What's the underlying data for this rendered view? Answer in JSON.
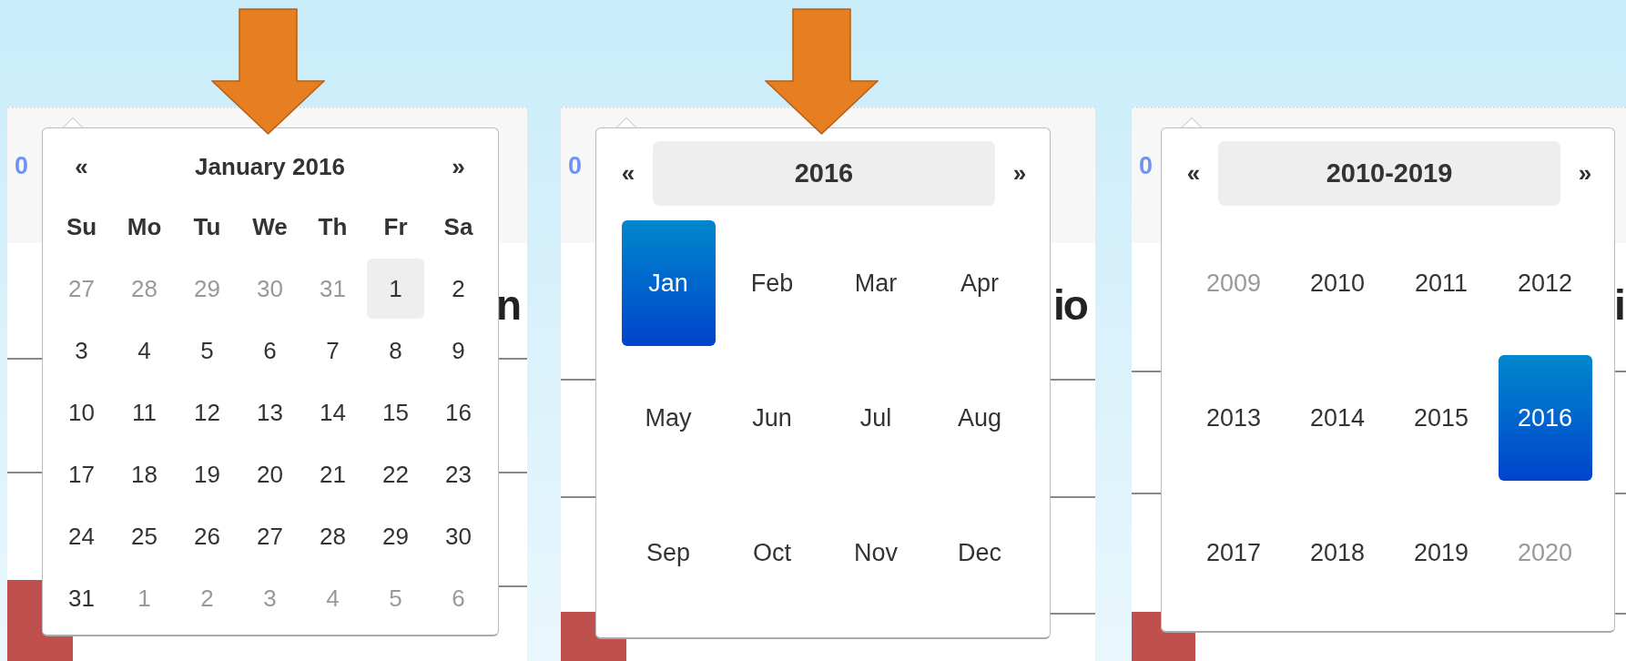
{
  "panels": [
    {
      "kind": "days",
      "pointer_arrow": true,
      "fragment_link": "0",
      "fragment_heading": "n",
      "picker": {
        "prev": "«",
        "title": "January 2016",
        "title_hovered": false,
        "next": "»",
        "weekdays": [
          "Su",
          "Mo",
          "Tu",
          "We",
          "Th",
          "Fr",
          "Sa"
        ],
        "cells": [
          {
            "label": "27",
            "muted": true,
            "selected": false,
            "hovered": false
          },
          {
            "label": "28",
            "muted": true,
            "selected": false,
            "hovered": false
          },
          {
            "label": "29",
            "muted": true,
            "selected": false,
            "hovered": false
          },
          {
            "label": "30",
            "muted": true,
            "selected": false,
            "hovered": false
          },
          {
            "label": "31",
            "muted": true,
            "selected": false,
            "hovered": false
          },
          {
            "label": "1",
            "muted": false,
            "selected": false,
            "hovered": true
          },
          {
            "label": "2",
            "muted": false,
            "selected": false,
            "hovered": false
          },
          {
            "label": "3",
            "muted": false,
            "selected": false,
            "hovered": false
          },
          {
            "label": "4",
            "muted": false,
            "selected": false,
            "hovered": false
          },
          {
            "label": "5",
            "muted": false,
            "selected": false,
            "hovered": false
          },
          {
            "label": "6",
            "muted": false,
            "selected": false,
            "hovered": false
          },
          {
            "label": "7",
            "muted": false,
            "selected": false,
            "hovered": false
          },
          {
            "label": "8",
            "muted": false,
            "selected": false,
            "hovered": false
          },
          {
            "label": "9",
            "muted": false,
            "selected": false,
            "hovered": false
          },
          {
            "label": "10",
            "muted": false,
            "selected": false,
            "hovered": false
          },
          {
            "label": "11",
            "muted": false,
            "selected": false,
            "hovered": false
          },
          {
            "label": "12",
            "muted": false,
            "selected": false,
            "hovered": false
          },
          {
            "label": "13",
            "muted": false,
            "selected": false,
            "hovered": false
          },
          {
            "label": "14",
            "muted": false,
            "selected": false,
            "hovered": false
          },
          {
            "label": "15",
            "muted": false,
            "selected": false,
            "hovered": false
          },
          {
            "label": "16",
            "muted": false,
            "selected": false,
            "hovered": false
          },
          {
            "label": "17",
            "muted": false,
            "selected": false,
            "hovered": false
          },
          {
            "label": "18",
            "muted": false,
            "selected": false,
            "hovered": false
          },
          {
            "label": "19",
            "muted": false,
            "selected": false,
            "hovered": false
          },
          {
            "label": "20",
            "muted": false,
            "selected": false,
            "hovered": false
          },
          {
            "label": "21",
            "muted": false,
            "selected": false,
            "hovered": false
          },
          {
            "label": "22",
            "muted": false,
            "selected": false,
            "hovered": false
          },
          {
            "label": "23",
            "muted": false,
            "selected": false,
            "hovered": false
          },
          {
            "label": "24",
            "muted": false,
            "selected": false,
            "hovered": false
          },
          {
            "label": "25",
            "muted": false,
            "selected": false,
            "hovered": false
          },
          {
            "label": "26",
            "muted": false,
            "selected": false,
            "hovered": false
          },
          {
            "label": "27",
            "muted": false,
            "selected": false,
            "hovered": false
          },
          {
            "label": "28",
            "muted": false,
            "selected": false,
            "hovered": false
          },
          {
            "label": "29",
            "muted": false,
            "selected": false,
            "hovered": false
          },
          {
            "label": "30",
            "muted": false,
            "selected": false,
            "hovered": false
          },
          {
            "label": "31",
            "muted": false,
            "selected": false,
            "hovered": false
          },
          {
            "label": "1",
            "muted": true,
            "selected": false,
            "hovered": false
          },
          {
            "label": "2",
            "muted": true,
            "selected": false,
            "hovered": false
          },
          {
            "label": "3",
            "muted": true,
            "selected": false,
            "hovered": false
          },
          {
            "label": "4",
            "muted": true,
            "selected": false,
            "hovered": false
          },
          {
            "label": "5",
            "muted": true,
            "selected": false,
            "hovered": false
          },
          {
            "label": "6",
            "muted": true,
            "selected": false,
            "hovered": false
          }
        ]
      }
    },
    {
      "kind": "months",
      "pointer_arrow": true,
      "fragment_link": "0",
      "fragment_heading": "io",
      "picker": {
        "prev": "«",
        "title": "2016",
        "title_hovered": true,
        "next": "»",
        "cells": [
          {
            "label": "Jan",
            "muted": false,
            "selected": true,
            "hovered": false
          },
          {
            "label": "Feb",
            "muted": false,
            "selected": false,
            "hovered": false
          },
          {
            "label": "Mar",
            "muted": false,
            "selected": false,
            "hovered": false
          },
          {
            "label": "Apr",
            "muted": false,
            "selected": false,
            "hovered": false
          },
          {
            "label": "May",
            "muted": false,
            "selected": false,
            "hovered": false
          },
          {
            "label": "Jun",
            "muted": false,
            "selected": false,
            "hovered": false
          },
          {
            "label": "Jul",
            "muted": false,
            "selected": false,
            "hovered": false
          },
          {
            "label": "Aug",
            "muted": false,
            "selected": false,
            "hovered": false
          },
          {
            "label": "Sep",
            "muted": false,
            "selected": false,
            "hovered": false
          },
          {
            "label": "Oct",
            "muted": false,
            "selected": false,
            "hovered": false
          },
          {
            "label": "Nov",
            "muted": false,
            "selected": false,
            "hovered": false
          },
          {
            "label": "Dec",
            "muted": false,
            "selected": false,
            "hovered": false
          }
        ]
      }
    },
    {
      "kind": "years",
      "pointer_arrow": false,
      "fragment_link": "0",
      "fragment_heading": "i",
      "picker": {
        "prev": "«",
        "title": "2010-2019",
        "title_hovered": true,
        "next": "»",
        "cells": [
          {
            "label": "2009",
            "muted": true,
            "selected": false,
            "hovered": false
          },
          {
            "label": "2010",
            "muted": false,
            "selected": false,
            "hovered": false
          },
          {
            "label": "2011",
            "muted": false,
            "selected": false,
            "hovered": false
          },
          {
            "label": "2012",
            "muted": false,
            "selected": false,
            "hovered": false
          },
          {
            "label": "2013",
            "muted": false,
            "selected": false,
            "hovered": false
          },
          {
            "label": "2014",
            "muted": false,
            "selected": false,
            "hovered": false
          },
          {
            "label": "2015",
            "muted": false,
            "selected": false,
            "hovered": false
          },
          {
            "label": "2016",
            "muted": false,
            "selected": true,
            "hovered": false
          },
          {
            "label": "2017",
            "muted": false,
            "selected": false,
            "hovered": false
          },
          {
            "label": "2018",
            "muted": false,
            "selected": false,
            "hovered": false
          },
          {
            "label": "2019",
            "muted": false,
            "selected": false,
            "hovered": false
          },
          {
            "label": "2020",
            "muted": true,
            "selected": false,
            "hovered": false
          }
        ]
      }
    }
  ]
}
